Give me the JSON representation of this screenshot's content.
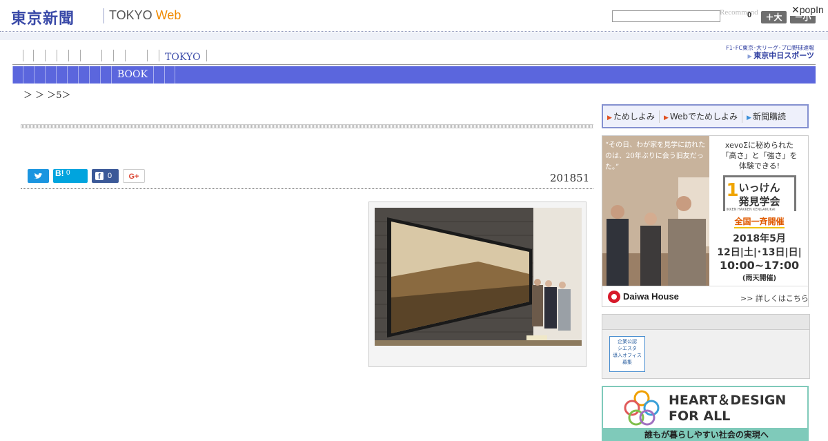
{
  "header": {
    "logo_ja": "東京新聞",
    "logo_en": "TOKYO",
    "logo_web": "Web",
    "recommend": "Recommend",
    "count": "0",
    "font_large": "＋大",
    "font_small": "－小",
    "popin": "✕popIn"
  },
  "nav1": {
    "items": [
      "",
      "",
      "",
      "",
      "",
      "",
      "",
      "",
      "",
      "",
      "TOKYO",
      ""
    ]
  },
  "chunichi": {
    "line1": "F1･FC東京･大リーグ･プロ野球速報",
    "line2": "東京中日スポーツ"
  },
  "nav2": {
    "items": [
      "",
      "",
      "",
      "",
      "",
      "",
      "",
      "",
      "",
      "BOOK",
      "",
      ""
    ]
  },
  "breadcrumb": "＞ ＞ ＞5＞",
  "article": {
    "date": "201851"
  },
  "share": {
    "twitter_icon": "twitter-icon",
    "hatena_label": "B!",
    "hatena_count": "0",
    "facebook_count": "0",
    "gplus_label": "G+"
  },
  "sidebar": {
    "tabs": [
      "ためしよみ",
      "Webでためしよみ",
      "新聞購読"
    ],
    "ad1": {
      "quote": "“その日、わが家を見学に訪れたのは、20年ぶりに会う旧友だった。”",
      "line1": "xevoΣに秘められた",
      "line2": "「高さ」と「強さ」を",
      "line3": "体験できる!",
      "badge_num": "1",
      "badge_title1": "いっけん",
      "badge_title2": "発見学会",
      "badge_sub": "IKKEN HAKKEN KENGAKUKAI",
      "event": "全国一斉開催",
      "year": "2018年5月",
      "days": "12日|土|･13日|日|",
      "hours": "10:00~17:00",
      "rain": "(雨天開催)",
      "brand": "Daiwa House",
      "more": ">> 詳しくはこちら"
    },
    "ad2": {
      "badge_line1": "企業公認",
      "badge_line2": "シエスタ",
      "badge_line3": "導入オフィス",
      "badge_line4": "募集"
    },
    "ad3": {
      "title1": "HEART＆DESIGN",
      "title2": "FOR ALL",
      "footer": "誰もが暮らしやすい社会の実現へ"
    }
  },
  "colors": {
    "brand_blue": "#3a4aa8",
    "nav_blue": "#5b66dd",
    "web_orange": "#f08a00",
    "twitter": "#1b95e0",
    "hatena": "#00a4de",
    "facebook": "#3b5998",
    "daiwa_red": "#d7192a"
  }
}
